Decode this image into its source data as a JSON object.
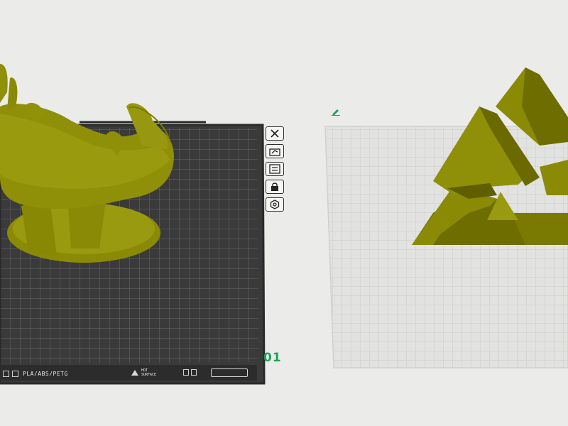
{
  "plate_1": {
    "number": "01",
    "material_label": "PLA/ABS/PETG",
    "surface_label_line1": "HOT",
    "surface_label_line2": "SURFACE"
  },
  "plate_tools": [
    {
      "name": "close-plate-button",
      "icon": "close-icon"
    },
    {
      "name": "auto-arrange-button",
      "icon": "arrange-icon"
    },
    {
      "name": "plate-settings-button",
      "icon": "settings-card-icon"
    },
    {
      "name": "lock-plate-button",
      "icon": "lock-icon"
    },
    {
      "name": "plate-options-button",
      "icon": "hexagon-icon"
    }
  ],
  "plate_2": {
    "edit_icon": "pencil-icon"
  },
  "colors": {
    "model": "#8b8b00",
    "plate_dark": "#3a3a3a",
    "plate_light": "#dcdcdc",
    "plate_number": "#1ea05a",
    "background": "#ebebe9"
  }
}
